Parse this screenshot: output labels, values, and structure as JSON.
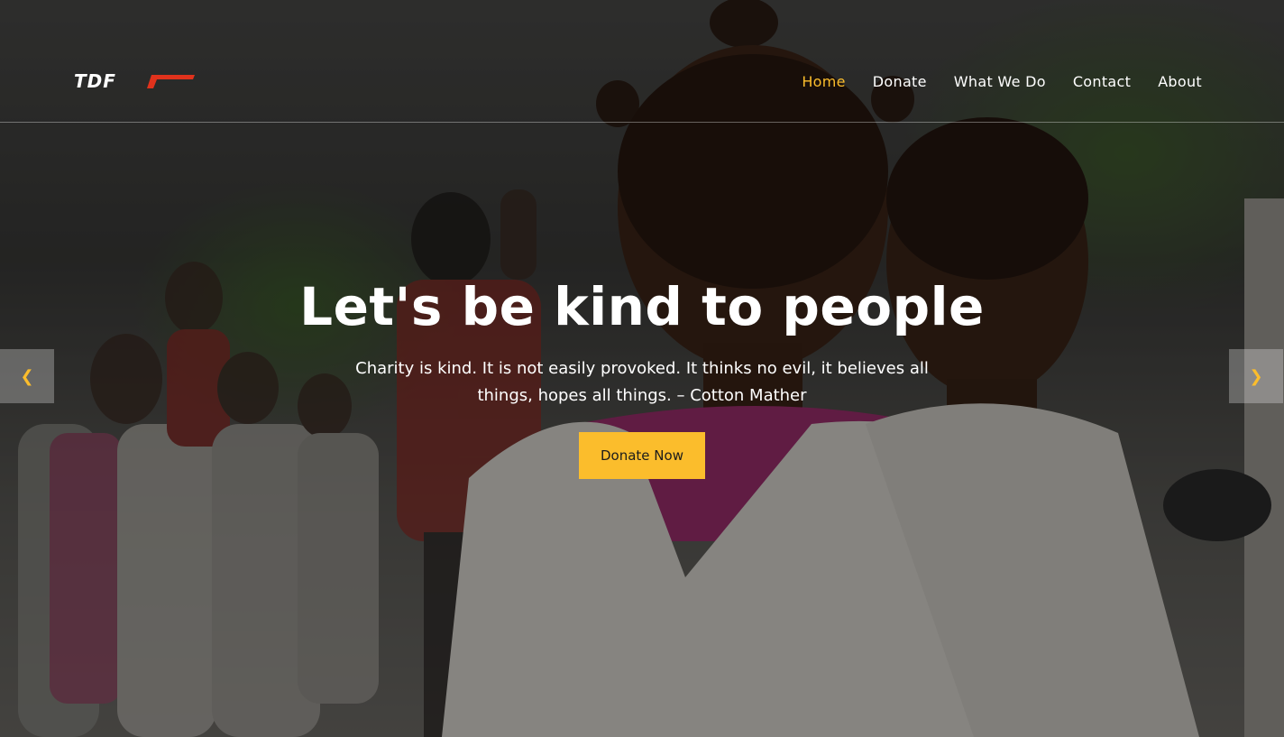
{
  "header": {
    "logo_text": "TDF",
    "nav": [
      {
        "label": "Home",
        "active": true
      },
      {
        "label": "Donate",
        "active": false
      },
      {
        "label": "What We Do",
        "active": false
      },
      {
        "label": "Contact",
        "active": false
      },
      {
        "label": "About",
        "active": false
      }
    ]
  },
  "hero": {
    "title": "Let's be kind to people",
    "quote": "Charity is kind. It is not easily provoked. It thinks no evil, it believes all things, hopes all things. – Cotton Mather",
    "cta_label": "Donate Now",
    "prev_icon": "chevron-left-icon",
    "next_icon": "chevron-right-icon"
  },
  "colors": {
    "accent": "#fbbd2c",
    "nav_text": "#ffffff",
    "logo_accent": "#e0321c"
  }
}
